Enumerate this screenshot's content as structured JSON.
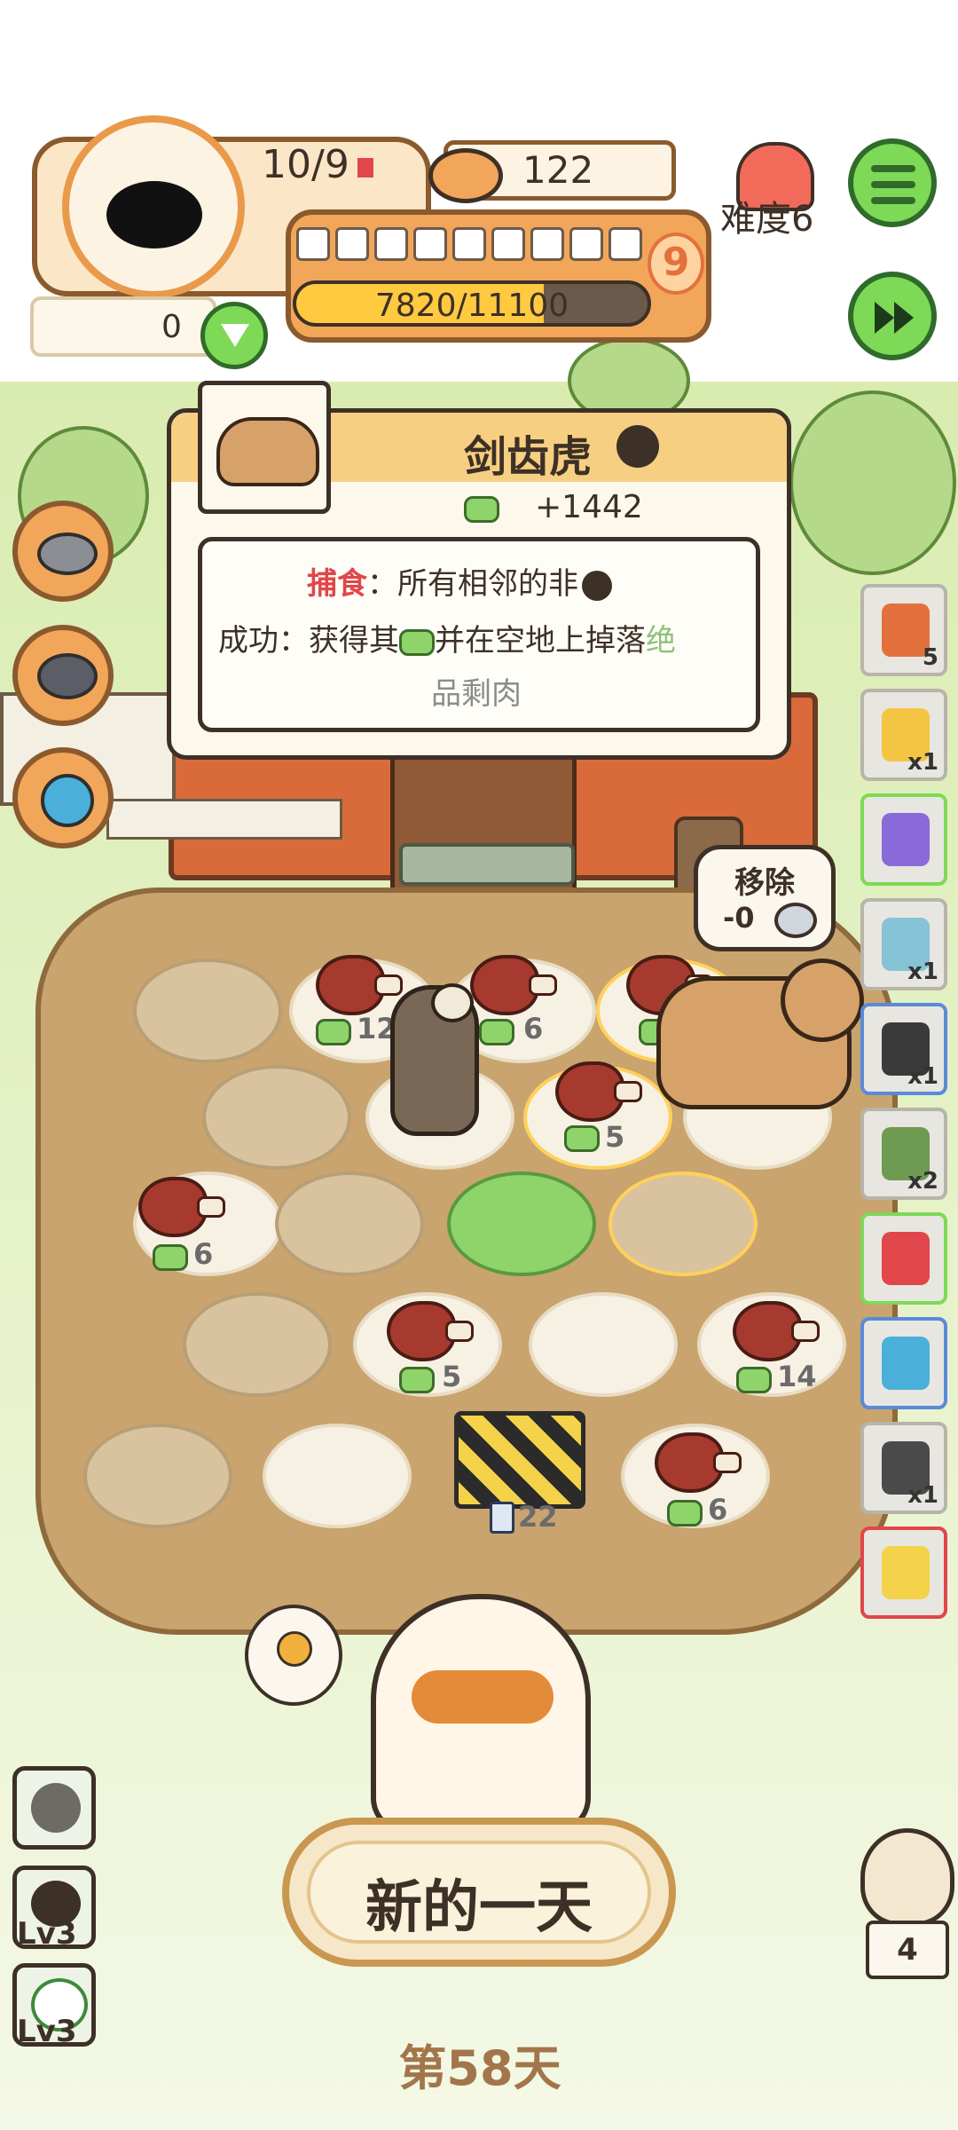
{
  "hud": {
    "population": "10/9",
    "cans": "122",
    "level_badge": "9",
    "xp_text": "7820/11100",
    "xp_fraction": 0.7045,
    "gift_count": "0",
    "difficulty": "难度6",
    "pips_total": 9
  },
  "panel": {
    "title": "剑齿虎",
    "reward": "+1442",
    "line1_keyword": "捕食",
    "line1_rest": "：所有相邻的非",
    "line2": "成功：获得其",
    "line2_rest": "并在空地上掉落",
    "line2_green": "绝",
    "line3": "品剩肉"
  },
  "remove_bubble": {
    "title": "移除",
    "value": "-0"
  },
  "board": {
    "meat_counts": [
      "12",
      "6",
      "5",
      "5",
      "6",
      "5",
      "14",
      "6"
    ],
    "barrier_timer": "22"
  },
  "sidebar": {
    "items": [
      {
        "icon": "card-icon",
        "count": "5"
      },
      {
        "icon": "crown-icon",
        "count": "x1"
      },
      {
        "icon": "credit-card-icon",
        "count": ""
      },
      {
        "icon": "mushroom-icon",
        "count": "x1"
      },
      {
        "icon": "scythe-icon",
        "count": "x1"
      },
      {
        "icon": "coin-card-icon",
        "count": "x2"
      },
      {
        "icon": "ticket-icon",
        "count": ""
      },
      {
        "icon": "grinder-icon",
        "count": ""
      },
      {
        "icon": "whistle-icon",
        "count": "x1"
      },
      {
        "icon": "scroll-icon",
        "count": ""
      }
    ]
  },
  "bottom_left": {
    "slots": [
      {
        "icon": "cat-silhouette-icon",
        "label": ""
      },
      {
        "icon": "black-cat-face-icon",
        "label": "Lv3"
      },
      {
        "icon": "white-cat-face-icon",
        "label": "Lv3"
      }
    ]
  },
  "owl": {
    "count": "4"
  },
  "actions": {
    "new_day": "新的一天",
    "day_label": "第58天"
  },
  "colors": {
    "accent_orange": "#f2a65a",
    "hud_green": "#7ed957",
    "xp_yellow": "#ffc940",
    "red_keyword": "#e0464a"
  }
}
